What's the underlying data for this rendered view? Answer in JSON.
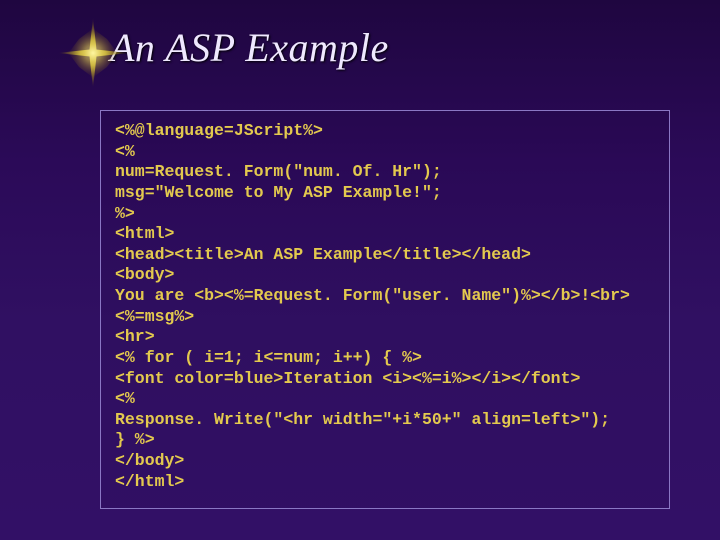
{
  "title": "An ASP Example",
  "code": [
    "<%@language=JScript%>",
    "<%",
    "num=Request. Form(\"num. Of. Hr\");",
    "msg=\"Welcome to My ASP Example!\";",
    "%>",
    "<html>",
    "<head><title>An ASP Example</title></head>",
    "<body>",
    "You are <b><%=Request. Form(\"user. Name\")%></b>!<br>",
    "<%=msg%>",
    "<hr>",
    "<% for ( i=1; i<=num; i++) { %>",
    "<font color=blue>Iteration <i><%=i%></i></font>",
    "<%",
    "Response. Write(\"<hr width=\"+i*50+\" align=left>\");",
    "} %>",
    "</body>",
    "</html>"
  ]
}
